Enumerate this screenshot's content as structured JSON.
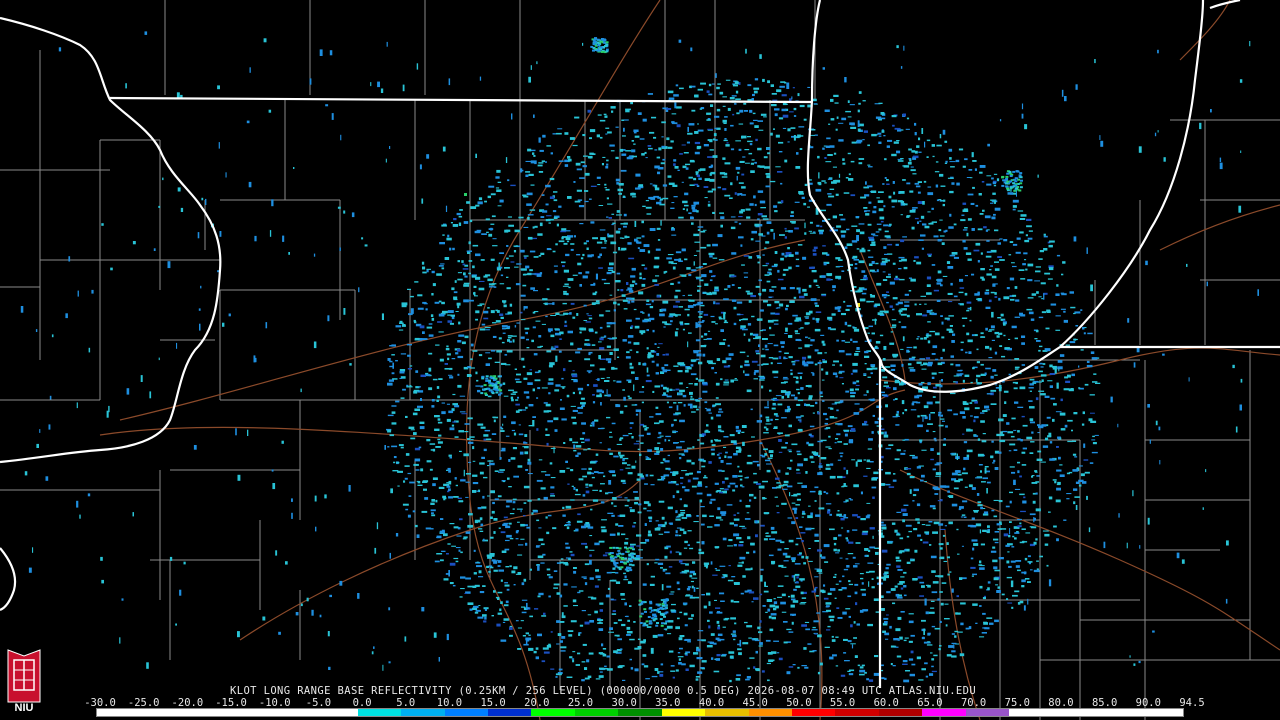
{
  "product": {
    "caption": "KLOT LONG RANGE BASE REFLECTIVITY (0.25KM / 256 LEVEL) (000000/0000 0.5 DEG) 2026-08-07 08:49 UTC  ATLAS.NIU.EDU",
    "radar_site": "KLOT",
    "product_name": "LONG RANGE BASE REFLECTIVITY",
    "resolution": "0.25KM / 256 LEVEL",
    "elevation": "0.5 DEG",
    "datetime": "2026-08-07 08:49 UTC",
    "source": "ATLAS.NIU.EDU"
  },
  "logo": {
    "text": "NIU",
    "color": "#c8102e"
  },
  "legend": {
    "tick_labels": [
      "-30.0",
      "-25.0",
      "-20.0",
      "-15.0",
      "-10.0",
      "-5.0",
      "0.0",
      "5.0",
      "10.0",
      "15.0",
      "20.0",
      "25.0",
      "30.0",
      "35.0",
      "40.0",
      "45.0",
      "50.0",
      "55.0",
      "60.0",
      "65.0",
      "70.0",
      "75.0",
      "80.0",
      "85.0",
      "90.0",
      "94.5"
    ],
    "tick_values": [
      -30,
      -25,
      -20,
      -15,
      -10,
      -5,
      0,
      5,
      10,
      15,
      20,
      25,
      30,
      35,
      40,
      45,
      50,
      55,
      60,
      65,
      70,
      75,
      80,
      85,
      90,
      94.5
    ],
    "colors": [
      "#ffffff",
      "#ffffff",
      "#ffffff",
      "#ffffff",
      "#ffffff",
      "#ffffff",
      "#00e0e0",
      "#00b0f0",
      "#0080ff",
      "#0030d0",
      "#00ff00",
      "#00d000",
      "#009000",
      "#ffff00",
      "#e8c000",
      "#ff9000",
      "#ff0000",
      "#d00000",
      "#b00000",
      "#ff00ff",
      "#9955c9",
      "#ffffff",
      "#ffffff",
      "#ffffff",
      "#ffffff"
    ]
  },
  "colors": {
    "state_border": "#ffffff",
    "county_border": "#8a8a8a",
    "highway": "#8b4a2a",
    "echo_light": "#29c4d6",
    "echo_mid": "#1e8fe0",
    "echo_dark": "#1b4fc0",
    "echo_green": "#2ad06a",
    "echo_yellow": "#f0e020"
  }
}
